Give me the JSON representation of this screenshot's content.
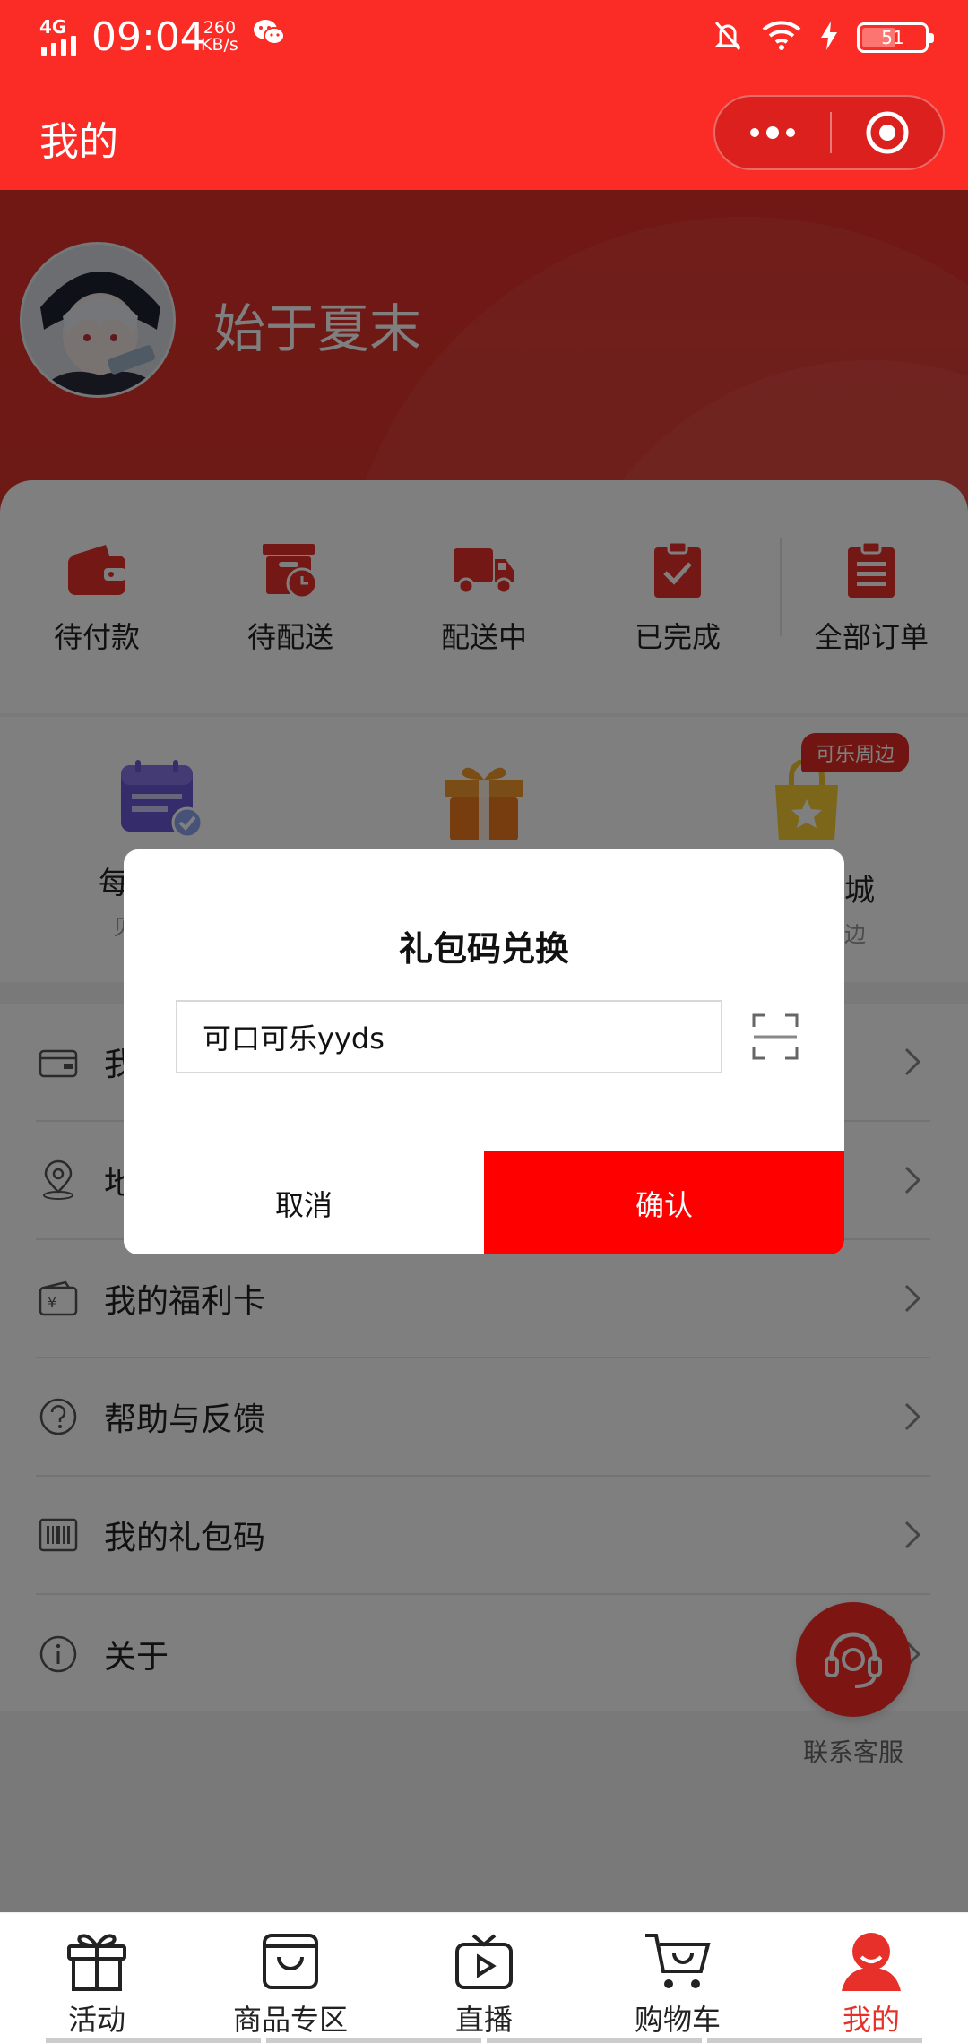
{
  "status_bar": {
    "network": "4G",
    "time": "09:04",
    "speed_value": "260",
    "speed_unit": "KB/s",
    "battery": "51"
  },
  "nav": {
    "title": "我的"
  },
  "profile": {
    "username": "始于夏末"
  },
  "orders": [
    {
      "label": "待付款",
      "icon": "wallet-icon"
    },
    {
      "label": "待配送",
      "icon": "schedule-box-icon"
    },
    {
      "label": "配送中",
      "icon": "truck-icon"
    },
    {
      "label": "已完成",
      "icon": "clipboard-check-icon"
    },
    {
      "label": "全部订单",
      "icon": "clipboard-list-icon"
    }
  ],
  "features": [
    {
      "label": "每",
      "sub": "贝",
      "icon": "calendar-check-icon"
    },
    {
      "label": "",
      "sub": "",
      "icon": "gift-box-icon"
    },
    {
      "label": "城",
      "sub": "边",
      "icon": "shopping-bag-star-icon",
      "badge": "可乐周边"
    }
  ],
  "menu": [
    {
      "label": "我",
      "icon": "card-icon"
    },
    {
      "label": "地",
      "icon": "location-icon"
    },
    {
      "label": "我的福利卡",
      "icon": "welfare-card-icon"
    },
    {
      "label": "帮助与反馈",
      "icon": "help-icon"
    },
    {
      "label": "我的礼包码",
      "icon": "barcode-icon"
    },
    {
      "label": "关于",
      "icon": "info-icon"
    }
  ],
  "customer_service": {
    "label": "联系客服"
  },
  "dialog": {
    "title": "礼包码兑换",
    "input_value": "可口可乐yyds",
    "cancel_label": "取消",
    "confirm_label": "确认"
  },
  "tabs": [
    {
      "label": "活动",
      "icon": "gift-icon"
    },
    {
      "label": "商品专区",
      "icon": "shopping-bag-icon"
    },
    {
      "label": "直播",
      "icon": "tv-play-icon"
    },
    {
      "label": "购物车",
      "icon": "cart-icon"
    },
    {
      "label": "我的",
      "icon": "user-icon",
      "active": true
    }
  ],
  "colors": {
    "brand_red": "#fb2b25",
    "confirm_red": "#ff0000",
    "active_tab": "#e8302a"
  }
}
